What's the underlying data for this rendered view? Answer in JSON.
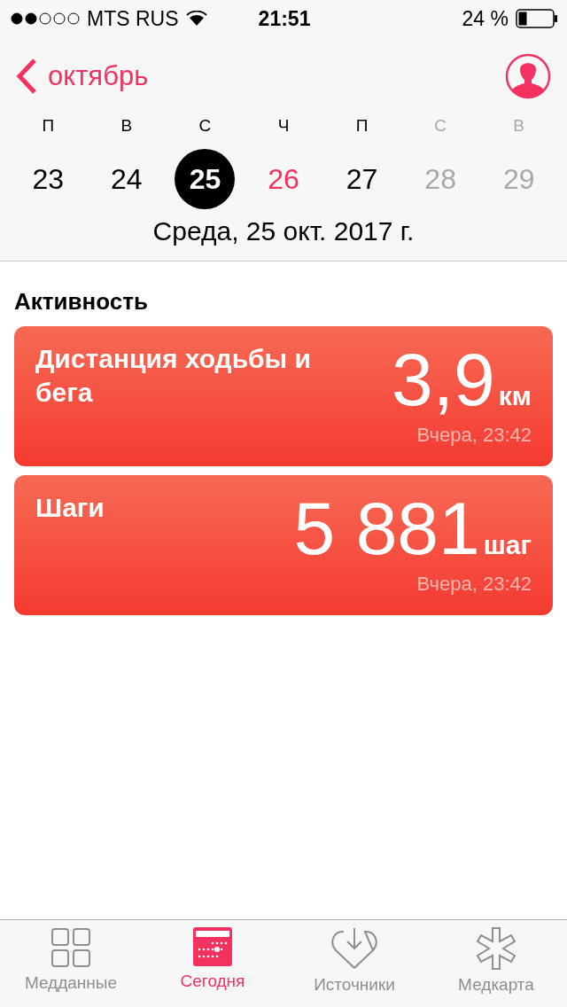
{
  "status_bar": {
    "carrier": "MTS RUS",
    "time": "21:51",
    "battery": "24 %"
  },
  "nav": {
    "back": "октябрь"
  },
  "week": [
    {
      "weekday": "П",
      "day": "23",
      "selected": false,
      "today": false,
      "weekend": false
    },
    {
      "weekday": "В",
      "day": "24",
      "selected": false,
      "today": false,
      "weekend": false
    },
    {
      "weekday": "С",
      "day": "25",
      "selected": true,
      "today": false,
      "weekend": false
    },
    {
      "weekday": "Ч",
      "day": "26",
      "selected": false,
      "today": true,
      "weekend": false
    },
    {
      "weekday": "П",
      "day": "27",
      "selected": false,
      "today": false,
      "weekend": false
    },
    {
      "weekday": "С",
      "day": "28",
      "selected": false,
      "today": false,
      "weekend": true
    },
    {
      "weekday": "В",
      "day": "29",
      "selected": false,
      "today": false,
      "weekend": true
    }
  ],
  "date_label": "Среда, 25 окт. 2017 г.",
  "section_title": "Активность",
  "cards": [
    {
      "title": "Дистанция ходьбы и бега",
      "value": "3,9",
      "unit": "км",
      "time": "Вчера, 23:42"
    },
    {
      "title": "Шаги",
      "value": "5 881",
      "unit": "шаг",
      "time": "Вчера, 23:42"
    }
  ],
  "tabs": [
    {
      "kind": "grid",
      "label": "Медданные",
      "selected": false
    },
    {
      "kind": "calendar",
      "label": "Сегодня",
      "selected": true
    },
    {
      "kind": "heart",
      "label": "Источники",
      "selected": false
    },
    {
      "kind": "star",
      "label": "Медкарта",
      "selected": false
    }
  ]
}
